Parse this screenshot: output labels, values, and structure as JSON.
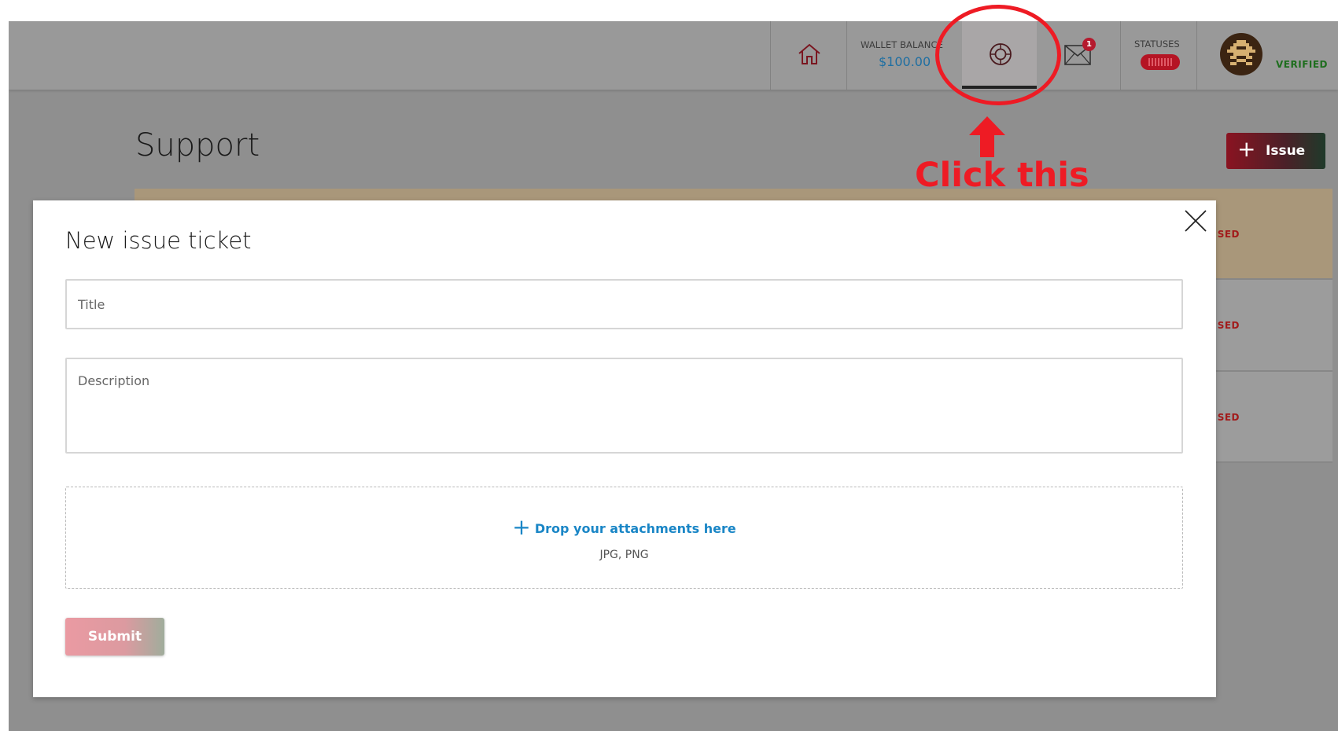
{
  "topbar": {
    "wallet_label": "WALLET BALANCE",
    "wallet_value": "$100.00",
    "mail_badge": "1",
    "statuses_label": "STATUSES",
    "verified_label": "VERIFIED"
  },
  "page": {
    "title": "Support",
    "issue_button_label": "Issue",
    "issue_button_icon": "+",
    "row_status_fragment": "SED"
  },
  "modal": {
    "title": "New issue ticket",
    "title_placeholder": "Title",
    "title_value": "",
    "description_placeholder": "Description",
    "description_value": "",
    "dropzone_icon": "+",
    "dropzone_text": "Drop your attachments here",
    "dropzone_hint": "JPG, PNG",
    "submit_label": "Submit"
  },
  "annotation": {
    "text": "Click this",
    "color": "#ee1b24"
  },
  "colors": {
    "accent_blue": "#1a86c6",
    "brand_red": "#b51a2e",
    "verified_green": "#1e6e1e"
  },
  "icons": {
    "home": "home-icon",
    "support": "lifebuoy-icon",
    "mail": "mail-icon",
    "close": "close-icon"
  }
}
